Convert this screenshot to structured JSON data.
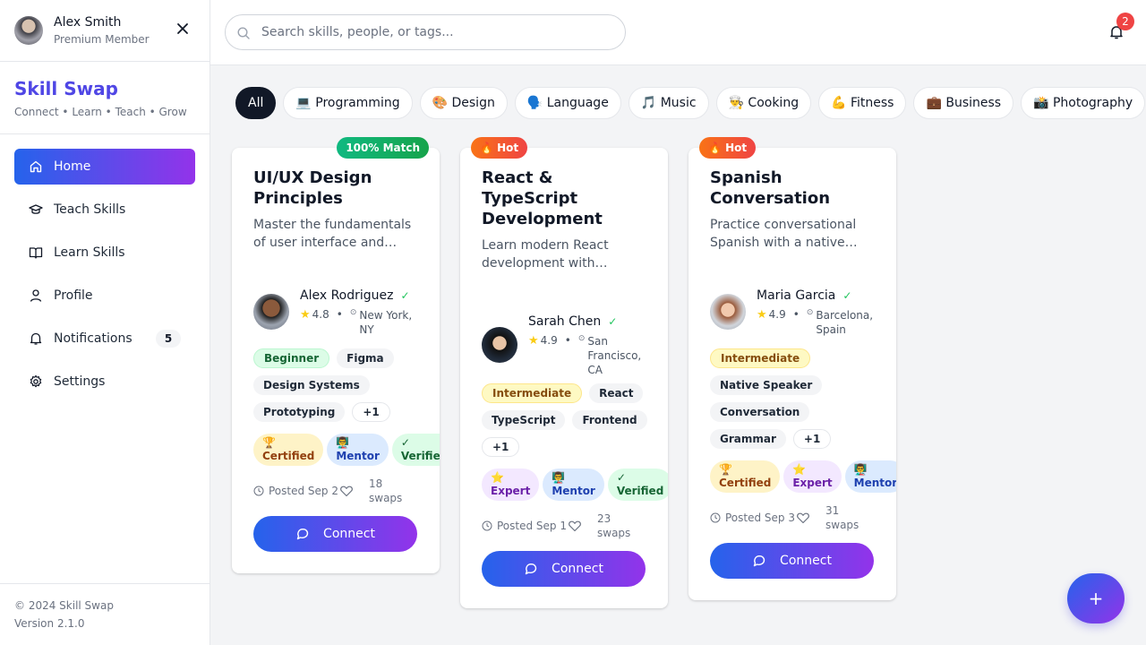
{
  "user": {
    "name": "Alex Smith",
    "plan": "Premium Member"
  },
  "brand": {
    "title": "Skill Swap",
    "tagline": "Connect • Learn • Teach • Grow"
  },
  "nav": [
    {
      "label": "Home",
      "icon": "home-icon",
      "active": true
    },
    {
      "label": "Teach Skills",
      "icon": "graduation-cap-icon"
    },
    {
      "label": "Learn Skills",
      "icon": "book-open-icon"
    },
    {
      "label": "Profile",
      "icon": "user-icon"
    },
    {
      "label": "Notifications",
      "icon": "bell-icon",
      "badge": "5"
    },
    {
      "label": "Settings",
      "icon": "gear-icon"
    }
  ],
  "footer": {
    "copyright": "© 2024 Skill Swap",
    "version": "Version 2.1.0"
  },
  "search": {
    "placeholder": "Search skills, people, or tags..."
  },
  "notifications": {
    "count": "2"
  },
  "filters": [
    "All",
    "💻 Programming",
    "🎨 Design",
    "🗣️ Language",
    "🎵 Music",
    "👨‍🍳 Cooking",
    "💪 Fitness",
    "💼 Business",
    "📸 Photography"
  ],
  "cards": [
    {
      "badge": "100% Match",
      "title": "UI/UX Design Principles",
      "description": "Master the fundamentals of user interface and…",
      "person": {
        "name": "Alex Rodriguez",
        "rating": "4.8",
        "location": "New York, NY"
      },
      "level": "Beginner",
      "tags": [
        "Figma",
        "Design Systems",
        "Prototyping"
      ],
      "more": "+1",
      "achievements": [
        {
          "icon": "🏆",
          "label": "Certified"
        },
        {
          "icon": "👨‍🏫",
          "label": "Mentor"
        },
        {
          "icon": "✓",
          "label": "Verified"
        }
      ],
      "posted": "Posted Sep 2",
      "swaps": "18 swaps",
      "cta": "Connect"
    },
    {
      "badge": "🔥 Hot",
      "title": "React & TypeScript Development",
      "description": "Learn modern React development with…",
      "person": {
        "name": "Sarah Chen",
        "rating": "4.9",
        "location": "San Francisco, CA"
      },
      "level": "Intermediate",
      "tags": [
        "React",
        "TypeScript",
        "Frontend"
      ],
      "more": "+1",
      "achievements": [
        {
          "icon": "⭐",
          "label": "Expert"
        },
        {
          "icon": "👨‍🏫",
          "label": "Mentor"
        },
        {
          "icon": "✓",
          "label": "Verified"
        }
      ],
      "posted": "Posted Sep 1",
      "swaps": "23 swaps",
      "cta": "Connect"
    },
    {
      "badge": "🔥 Hot",
      "title": "Spanish Conversation",
      "description": "Practice conversational Spanish with a native…",
      "person": {
        "name": "Maria Garcia",
        "rating": "4.9",
        "location": "Barcelona, Spain"
      },
      "level": "Intermediate",
      "tags": [
        "Native Speaker",
        "Conversation",
        "Grammar"
      ],
      "more": "+1",
      "achievements": [
        {
          "icon": "🏆",
          "label": "Certified"
        },
        {
          "icon": "⭐",
          "label": "Expert"
        },
        {
          "icon": "👨‍🏫",
          "label": "Mentor"
        }
      ],
      "posted": "Posted Sep 3",
      "swaps": "31 swaps",
      "cta": "Connect"
    }
  ],
  "fab": {
    "label": "+"
  }
}
